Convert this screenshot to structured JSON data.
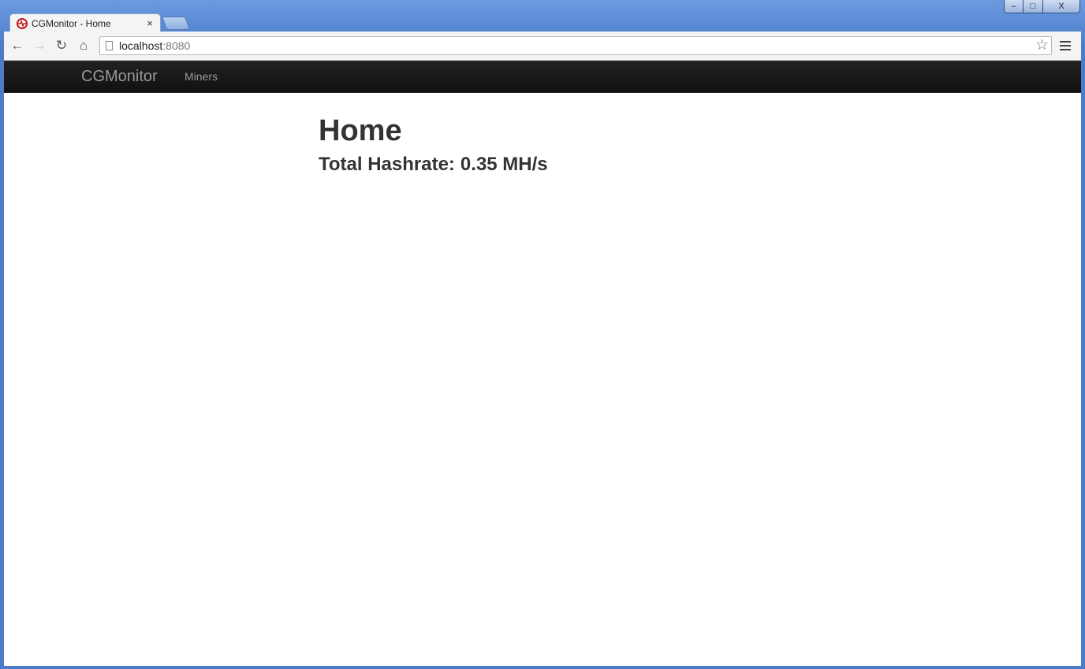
{
  "browser": {
    "tab": {
      "title": "CGMonitor - Home",
      "close_glyph": "×"
    },
    "toolbar": {
      "back_glyph": "←",
      "forward_glyph": "→",
      "reload_glyph": "↻",
      "home_glyph": "⌂",
      "star_glyph": "☆"
    },
    "address": {
      "host": "localhost",
      "port": ":8080"
    },
    "window_controls": {
      "minimize_glyph": "–",
      "maximize_glyph": "□",
      "close_glyph": "X"
    }
  },
  "navbar": {
    "brand": "CGMonitor",
    "links": [
      {
        "label": "Miners"
      }
    ]
  },
  "main": {
    "title": "Home",
    "hashrate_label": "Total Hashrate:",
    "hashrate_value": "0.35 MH/s"
  },
  "colors": {
    "navbar_bg": "#1b1b1b",
    "navbar_text": "#999999",
    "heading_text": "#333333",
    "favicon_accent": "#c0171d",
    "window_frame": "#4a7cc9"
  },
  "icons": [
    "app-favicon-icon",
    "back-arrow-icon",
    "forward-arrow-icon",
    "reload-icon",
    "home-icon",
    "page-icon",
    "star-icon",
    "menu-icon"
  ]
}
